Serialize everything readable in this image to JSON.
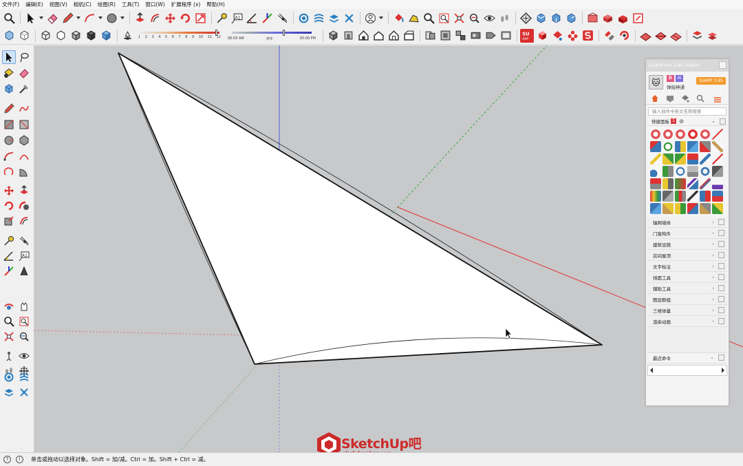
{
  "menu": [
    "文件(F)",
    "编辑(E)",
    "视图(V)",
    "相机(C)",
    "绘图(R)",
    "工具(T)",
    "窗口(W)",
    "扩展程序 (x)",
    "帮助(H)"
  ],
  "toolbar_slider": {
    "fog_ticks": [
      "1",
      "2",
      "3",
      "4",
      "5",
      "6",
      "7",
      "8",
      "9",
      "10",
      "11",
      "12"
    ],
    "time_start": "06:55 AM",
    "time_mid": "中午",
    "time_end": "05:00 PM"
  },
  "suapp": {
    "title": "SUAPP Pro 3.85 (64bit)",
    "badge_a": "脉",
    "badge_b": "AI",
    "username": "弹指神通",
    "version_badge": "SUAPP 3.85",
    "search_placeholder": "输入插件中英文名称搜索",
    "quick_panel_label": "快捷面板",
    "quick_panel_num": "1",
    "categories": [
      "轴网墙体",
      "门窗构件",
      "建筑设施",
      "房间屋顶",
      "文字标注",
      "线面工具",
      "辅助工具",
      "图层群组",
      "三维体量",
      "渲染动画"
    ],
    "recent_label": "最近命令"
  },
  "status": {
    "text": "单击或拖动以选择对象。Shift = 加/减。Ctrl = 加。Shift + Ctrl = 减。"
  },
  "watermark": {
    "brand": "SketchUp吧",
    "url": "sketchupbar.com"
  },
  "colors": {
    "viewport_bg": "#c8c9cb",
    "axis_red": "#e03535",
    "axis_green": "#38a838",
    "axis_blue": "#4a5fd6",
    "brand_red": "#cc2a2a",
    "suapp_orange": "#f39a2b"
  }
}
